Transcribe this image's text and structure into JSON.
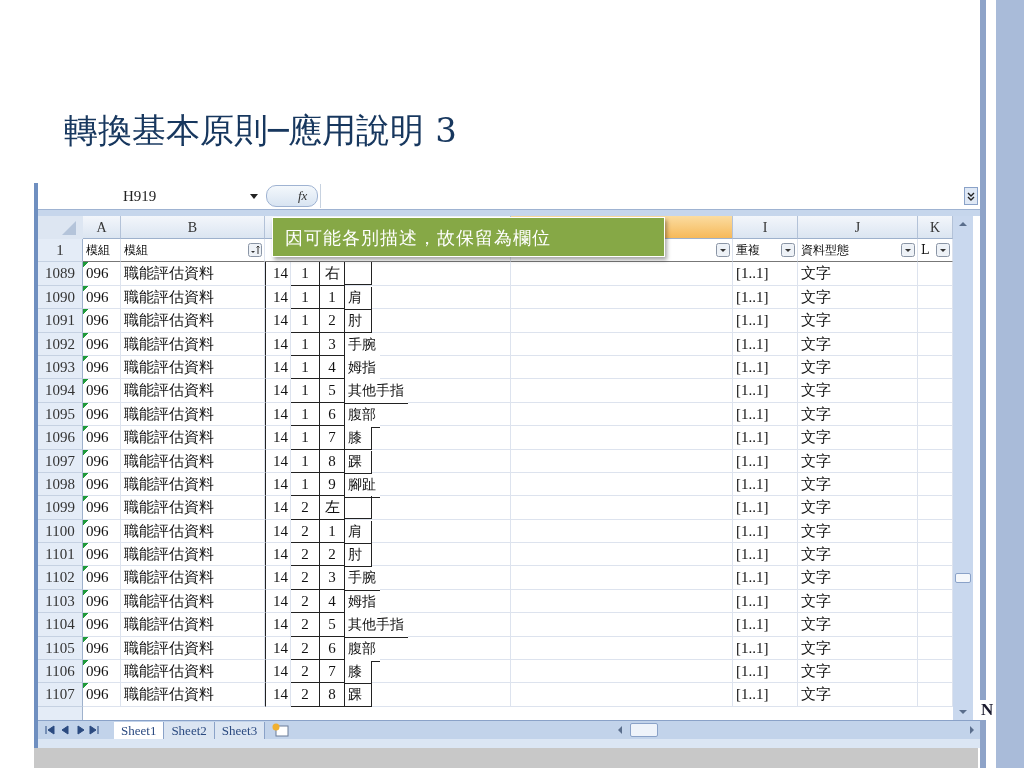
{
  "slide": {
    "title": "轉換基本原則─應用說明 3",
    "edge_mark": "N"
  },
  "spreadsheet": {
    "name_box": "H919",
    "fx_label": "fx",
    "column_headers": [
      {
        "label": "A",
        "selected": false
      },
      {
        "label": "B",
        "selected": false
      },
      {
        "selected": false
      },
      {
        "selected": true
      },
      {
        "label": "I",
        "selected": false
      },
      {
        "label": "J",
        "selected": false
      },
      {
        "label": "K",
        "selected": false
      }
    ],
    "header_row": {
      "number": "1",
      "cells": [
        {
          "text": "模組"
        },
        {
          "text": "模組",
          "kind": "sort"
        },
        {},
        {
          "kind": "dropdown"
        },
        {
          "text": "重複",
          "kind": "dropdown"
        },
        {
          "text": "資料型態",
          "kind": "dropdown"
        },
        {
          "text": "L",
          "kind": "dropdown"
        }
      ]
    },
    "rows": [
      {
        "number": "1089",
        "a": "096",
        "b": "職能評估資料",
        "c": "14",
        "d": "1",
        "e": "右",
        "i": "[1..1]",
        "j": "文字"
      },
      {
        "number": "1090",
        "a": "096",
        "b": "職能評估資料",
        "c": "14",
        "d": "1",
        "e": "1",
        "f": "肩",
        "i": "[1..1]",
        "j": "文字"
      },
      {
        "number": "1091",
        "a": "096",
        "b": "職能評估資料",
        "c": "14",
        "d": "1",
        "e": "2",
        "f": "肘",
        "i": "[1..1]",
        "j": "文字"
      },
      {
        "number": "1092",
        "a": "096",
        "b": "職能評估資料",
        "c": "14",
        "d": "1",
        "e": "3",
        "f": "手腕",
        "i": "[1..1]",
        "j": "文字"
      },
      {
        "number": "1093",
        "a": "096",
        "b": "職能評估資料",
        "c": "14",
        "d": "1",
        "e": "4",
        "f": "姆指",
        "i": "[1..1]",
        "j": "文字"
      },
      {
        "number": "1094",
        "a": "096",
        "b": "職能評估資料",
        "c": "14",
        "d": "1",
        "e": "5",
        "f": "其他手指",
        "i": "[1..1]",
        "j": "文字"
      },
      {
        "number": "1095",
        "a": "096",
        "b": "職能評估資料",
        "c": "14",
        "d": "1",
        "e": "6",
        "f": "腹部",
        "i": "[1..1]",
        "j": "文字"
      },
      {
        "number": "1096",
        "a": "096",
        "b": "職能評估資料",
        "c": "14",
        "d": "1",
        "e": "7",
        "f": "膝",
        "i": "[1..1]",
        "j": "文字"
      },
      {
        "number": "1097",
        "a": "096",
        "b": "職能評估資料",
        "c": "14",
        "d": "1",
        "e": "8",
        "f": "踝",
        "i": "[1..1]",
        "j": "文字"
      },
      {
        "number": "1098",
        "a": "096",
        "b": "職能評估資料",
        "c": "14",
        "d": "1",
        "e": "9",
        "f": "腳趾",
        "i": "[1..1]",
        "j": "文字"
      },
      {
        "number": "1099",
        "a": "096",
        "b": "職能評估資料",
        "c": "14",
        "d": "2",
        "e": "左",
        "i": "[1..1]",
        "j": "文字"
      },
      {
        "number": "1100",
        "a": "096",
        "b": "職能評估資料",
        "c": "14",
        "d": "2",
        "e": "1",
        "f": "肩",
        "i": "[1..1]",
        "j": "文字"
      },
      {
        "number": "1101",
        "a": "096",
        "b": "職能評估資料",
        "c": "14",
        "d": "2",
        "e": "2",
        "f": "肘",
        "i": "[1..1]",
        "j": "文字"
      },
      {
        "number": "1102",
        "a": "096",
        "b": "職能評估資料",
        "c": "14",
        "d": "2",
        "e": "3",
        "f": "手腕",
        "i": "[1..1]",
        "j": "文字"
      },
      {
        "number": "1103",
        "a": "096",
        "b": "職能評估資料",
        "c": "14",
        "d": "2",
        "e": "4",
        "f": "姆指",
        "i": "[1..1]",
        "j": "文字"
      },
      {
        "number": "1104",
        "a": "096",
        "b": "職能評估資料",
        "c": "14",
        "d": "2",
        "e": "5",
        "f": "其他手指",
        "i": "[1..1]",
        "j": "文字"
      },
      {
        "number": "1105",
        "a": "096",
        "b": "職能評估資料",
        "c": "14",
        "d": "2",
        "e": "6",
        "f": "腹部",
        "i": "[1..1]",
        "j": "文字"
      },
      {
        "number": "1106",
        "a": "096",
        "b": "職能評估資料",
        "c": "14",
        "d": "2",
        "e": "7",
        "f": "膝",
        "i": "[1..1]",
        "j": "文字"
      },
      {
        "number": "1107",
        "a": "096",
        "b": "職能評估資料",
        "c": "14",
        "d": "2",
        "e": "8",
        "f": "踝",
        "i": "[1..1]",
        "j": "文字"
      }
    ],
    "sheet_tabs": [
      {
        "label": "Sheet1",
        "selected": true
      },
      {
        "label": "Sheet2",
        "selected": false
      },
      {
        "label": "Sheet3",
        "selected": false
      }
    ]
  },
  "callout": {
    "text": "因可能各別描述，故保留為欄位"
  }
}
